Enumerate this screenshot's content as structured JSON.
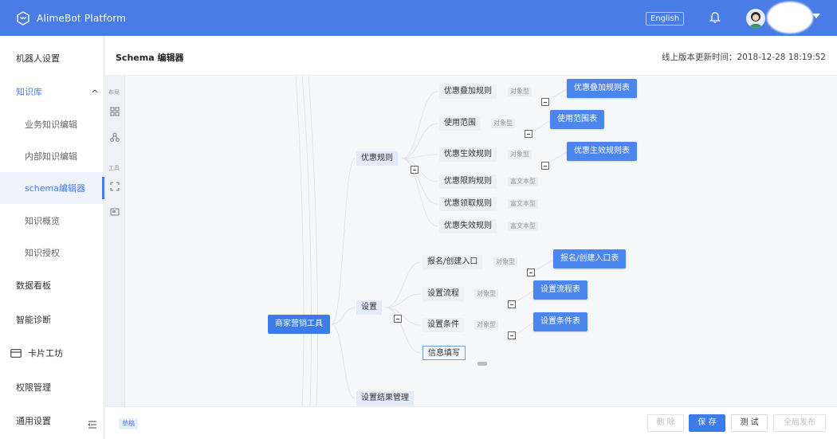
{
  "topbar": {
    "app_title": "AlimeBot Platform",
    "language": "English",
    "bell_icon": "bell-icon",
    "avatar_icon": "avatar-icon",
    "caret_icon": "caret-down-icon",
    "color": "#4a7ce6"
  },
  "sidebar": {
    "items": [
      {
        "label": "机器人设置"
      },
      {
        "label": "知识库"
      },
      {
        "label": "业务知识编辑"
      },
      {
        "label": "内部知识编辑"
      },
      {
        "label": "schema编辑器"
      },
      {
        "label": "知识概览"
      },
      {
        "label": "知识授权"
      },
      {
        "label": "数据看板"
      },
      {
        "label": "智能诊断"
      },
      {
        "label": "卡片工坊"
      },
      {
        "label": "权限管理"
      },
      {
        "label": "通用设置"
      }
    ]
  },
  "header": {
    "title": "Schema 编辑器",
    "version_label": "线上版本更新时间：2018-12-28 18:19:52"
  },
  "toolbar": {
    "layout_label": "布局",
    "tools_label": "工具"
  },
  "mindmap": {
    "root": "商家营销工具",
    "branch1": "优惠规则",
    "branch2": "设置",
    "branch3": "设置结果管理",
    "rules": [
      {
        "label": "优惠叠加规则",
        "type": "对象型",
        "table": "优惠叠加规则表"
      },
      {
        "label": "使用范围",
        "type": "对象型",
        "table": "使用范围表"
      },
      {
        "label": "优惠生效规则",
        "type": "对象型",
        "table": "优惠生效规则表"
      },
      {
        "label": "优惠限购规则",
        "type": "富文本型"
      },
      {
        "label": "优惠领取规则",
        "type": "富文本型"
      },
      {
        "label": "优惠失效规则",
        "type": "富文本型"
      }
    ],
    "settings": [
      {
        "label": "报名/创建入口",
        "type": "对象型",
        "table": "报名/创建入口表"
      },
      {
        "label": "设置流程",
        "type": "对象型",
        "table": "设置流程表"
      },
      {
        "label": "设置条件",
        "type": "对象型",
        "table": "设置条件表"
      },
      {
        "label": "信息填写"
      }
    ]
  },
  "footer": {
    "draft_badge": "草稿",
    "delete_label": "删 除",
    "save_label": "保 存",
    "test_label": "测 试",
    "publish_label": "全局发布"
  }
}
